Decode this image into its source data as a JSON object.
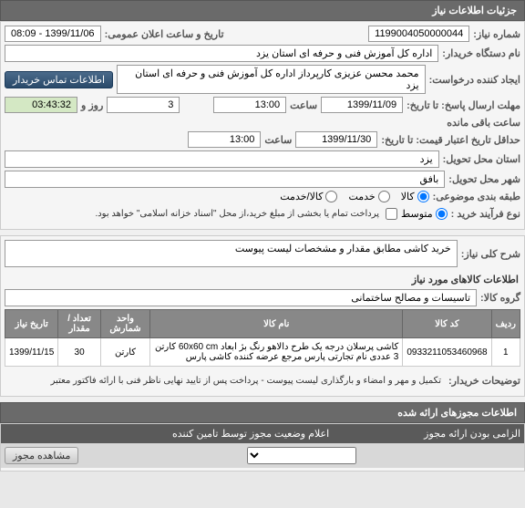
{
  "panel1": {
    "title": "جزئیات اطلاعات نیاز",
    "need_number_label": "شماره نیاز:",
    "need_number": "1199004050000044",
    "announce_label": "تاریخ و ساعت اعلان عمومی:",
    "announce_value": "1399/11/06 - 08:09",
    "buyer_org_label": "نام دستگاه خریدار:",
    "buyer_org": "اداره کل آموزش فنی و حرفه ای استان یزد",
    "creator_label": "ایجاد کننده درخواست:",
    "creator": "محمد محسن عزیزی کارپرداز اداره کل آموزش فنی و حرفه ای استان یزد",
    "contact_btn": "اطلاعات تماس خریدار",
    "deadline_send_label": "مهلت ارسال پاسخ: تا تاریخ:",
    "deadline_send_date": "1399/11/09",
    "time_label": "ساعت",
    "deadline_send_time": "13:00",
    "days_remaining": "3",
    "days_and": "روز و",
    "time_remaining": "03:43:32",
    "time_remaining_label": "ساعت باقی مانده",
    "deadline_price_label": "حداقل تاریخ اعتبار قیمت: تا تاریخ:",
    "deadline_price_date": "1399/11/30",
    "deadline_price_time": "13:00",
    "delivery_province_label": "استان محل تحویل:",
    "delivery_province": "یزد",
    "delivery_city_label": "شهر محل تحویل:",
    "delivery_city": "بافق",
    "budget_class_label": "طبقه بندی موضوعی:",
    "budget_goods": "کالا",
    "budget_service": "خدمت",
    "budget_goods_service": "کالا/خدمت",
    "purchase_type_label": "نوع فرآیند خرید :",
    "purchase_type_small": "متوسط",
    "purchase_note": "پرداخت تمام یا بخشی از مبلغ خرید،از محل \"اسناد خزانه اسلامی\" خواهد بود."
  },
  "panel2": {
    "desc_label": "شرح کلی نیاز:",
    "desc": "خرید کاشی مطابق مقدار و مشخصات لیست پیوست",
    "goods_info_title": "اطلاعات کالاهای مورد نیاز",
    "goods_group_label": "گروه کالا:",
    "goods_group": "تاسیسات و مصالح ساختمانی",
    "table": {
      "headers": [
        "ردیف",
        "کد کالا",
        "نام کالا",
        "واحد شمارش",
        "تعداد / مقدار",
        "تاریخ نیاز"
      ],
      "rows": [
        [
          "1",
          "0933211053460968",
          "کاشی پرسلان درجه یک طرح دالاهو رنگ بژ ابعاد 60x60 cm کارتن 3 عددی نام تجارتی پارس مرجع عرضه کننده کاشی پارس",
          "کارتن",
          "30",
          "1399/11/15"
        ]
      ]
    },
    "buyer_note_label": "توضیحات خریدار:",
    "buyer_note": "تکمیل و مهر و امضاء و بارگذاری لیست پیوست - پرداخت پس از تایید نهایی ناظر فنی با ارائه فاکتور معتبر"
  },
  "panel3": {
    "title": "اطلاعات مجوزهای ارائه شده",
    "mandatory_label": "الزامی بودن ارائه مجوز",
    "status_label": "اعلام وضعیت مجوز توسط تامین کننده",
    "view_btn": "مشاهده مجوز"
  }
}
